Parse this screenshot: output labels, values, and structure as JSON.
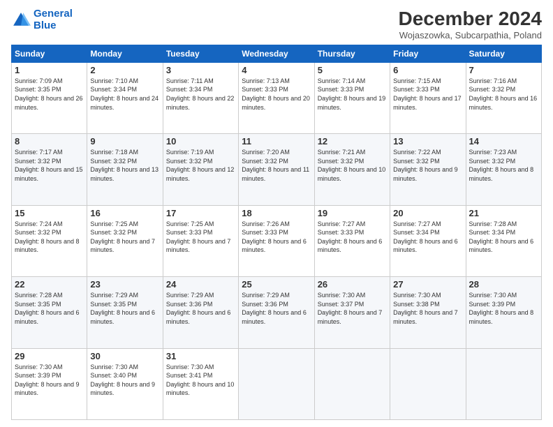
{
  "logo": {
    "line1": "General",
    "line2": "Blue"
  },
  "title": "December 2024",
  "subtitle": "Wojaszowka, Subcarpathia, Poland",
  "days_header": [
    "Sunday",
    "Monday",
    "Tuesday",
    "Wednesday",
    "Thursday",
    "Friday",
    "Saturday"
  ],
  "weeks": [
    [
      {
        "day": 1,
        "sunrise": "7:09 AM",
        "sunset": "3:35 PM",
        "daylight": "8 hours and 26 minutes."
      },
      {
        "day": 2,
        "sunrise": "7:10 AM",
        "sunset": "3:34 PM",
        "daylight": "8 hours and 24 minutes."
      },
      {
        "day": 3,
        "sunrise": "7:11 AM",
        "sunset": "3:34 PM",
        "daylight": "8 hours and 22 minutes."
      },
      {
        "day": 4,
        "sunrise": "7:13 AM",
        "sunset": "3:33 PM",
        "daylight": "8 hours and 20 minutes."
      },
      {
        "day": 5,
        "sunrise": "7:14 AM",
        "sunset": "3:33 PM",
        "daylight": "8 hours and 19 minutes."
      },
      {
        "day": 6,
        "sunrise": "7:15 AM",
        "sunset": "3:33 PM",
        "daylight": "8 hours and 17 minutes."
      },
      {
        "day": 7,
        "sunrise": "7:16 AM",
        "sunset": "3:32 PM",
        "daylight": "8 hours and 16 minutes."
      }
    ],
    [
      {
        "day": 8,
        "sunrise": "7:17 AM",
        "sunset": "3:32 PM",
        "daylight": "8 hours and 15 minutes."
      },
      {
        "day": 9,
        "sunrise": "7:18 AM",
        "sunset": "3:32 PM",
        "daylight": "8 hours and 13 minutes."
      },
      {
        "day": 10,
        "sunrise": "7:19 AM",
        "sunset": "3:32 PM",
        "daylight": "8 hours and 12 minutes."
      },
      {
        "day": 11,
        "sunrise": "7:20 AM",
        "sunset": "3:32 PM",
        "daylight": "8 hours and 11 minutes."
      },
      {
        "day": 12,
        "sunrise": "7:21 AM",
        "sunset": "3:32 PM",
        "daylight": "8 hours and 10 minutes."
      },
      {
        "day": 13,
        "sunrise": "7:22 AM",
        "sunset": "3:32 PM",
        "daylight": "8 hours and 9 minutes."
      },
      {
        "day": 14,
        "sunrise": "7:23 AM",
        "sunset": "3:32 PM",
        "daylight": "8 hours and 8 minutes."
      }
    ],
    [
      {
        "day": 15,
        "sunrise": "7:24 AM",
        "sunset": "3:32 PM",
        "daylight": "8 hours and 8 minutes."
      },
      {
        "day": 16,
        "sunrise": "7:25 AM",
        "sunset": "3:32 PM",
        "daylight": "8 hours and 7 minutes."
      },
      {
        "day": 17,
        "sunrise": "7:25 AM",
        "sunset": "3:33 PM",
        "daylight": "8 hours and 7 minutes."
      },
      {
        "day": 18,
        "sunrise": "7:26 AM",
        "sunset": "3:33 PM",
        "daylight": "8 hours and 6 minutes."
      },
      {
        "day": 19,
        "sunrise": "7:27 AM",
        "sunset": "3:33 PM",
        "daylight": "8 hours and 6 minutes."
      },
      {
        "day": 20,
        "sunrise": "7:27 AM",
        "sunset": "3:34 PM",
        "daylight": "8 hours and 6 minutes."
      },
      {
        "day": 21,
        "sunrise": "7:28 AM",
        "sunset": "3:34 PM",
        "daylight": "8 hours and 6 minutes."
      }
    ],
    [
      {
        "day": 22,
        "sunrise": "7:28 AM",
        "sunset": "3:35 PM",
        "daylight": "8 hours and 6 minutes."
      },
      {
        "day": 23,
        "sunrise": "7:29 AM",
        "sunset": "3:35 PM",
        "daylight": "8 hours and 6 minutes."
      },
      {
        "day": 24,
        "sunrise": "7:29 AM",
        "sunset": "3:36 PM",
        "daylight": "8 hours and 6 minutes."
      },
      {
        "day": 25,
        "sunrise": "7:29 AM",
        "sunset": "3:36 PM",
        "daylight": "8 hours and 6 minutes."
      },
      {
        "day": 26,
        "sunrise": "7:30 AM",
        "sunset": "3:37 PM",
        "daylight": "8 hours and 7 minutes."
      },
      {
        "day": 27,
        "sunrise": "7:30 AM",
        "sunset": "3:38 PM",
        "daylight": "8 hours and 7 minutes."
      },
      {
        "day": 28,
        "sunrise": "7:30 AM",
        "sunset": "3:39 PM",
        "daylight": "8 hours and 8 minutes."
      }
    ],
    [
      {
        "day": 29,
        "sunrise": "7:30 AM",
        "sunset": "3:39 PM",
        "daylight": "8 hours and 9 minutes."
      },
      {
        "day": 30,
        "sunrise": "7:30 AM",
        "sunset": "3:40 PM",
        "daylight": "8 hours and 9 minutes."
      },
      {
        "day": 31,
        "sunrise": "7:30 AM",
        "sunset": "3:41 PM",
        "daylight": "8 hours and 10 minutes."
      },
      null,
      null,
      null,
      null
    ]
  ],
  "labels": {
    "sunrise": "Sunrise:",
    "sunset": "Sunset:",
    "daylight": "Daylight:"
  }
}
